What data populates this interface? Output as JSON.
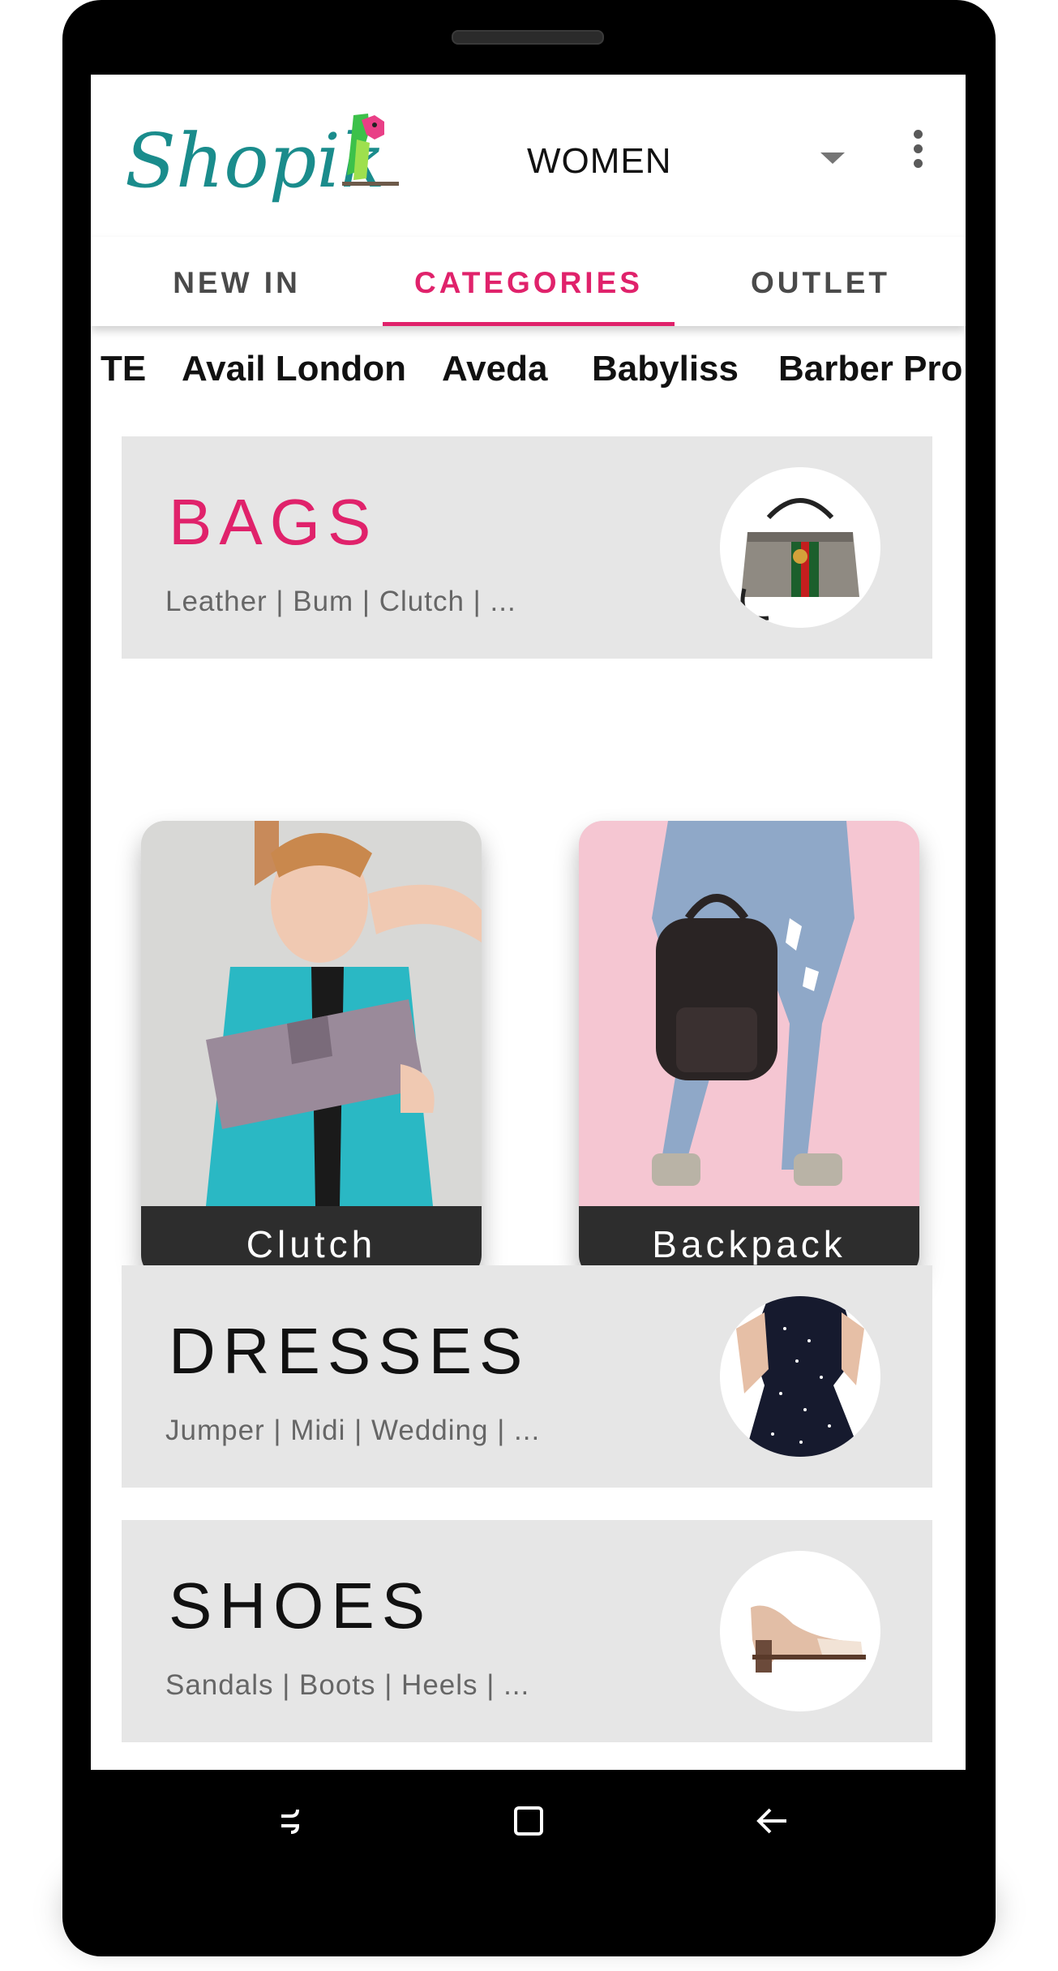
{
  "app": {
    "logo_text": "Shopik",
    "gender_selector": "WOMEN",
    "colors": {
      "accent": "#e0226b",
      "logo_teal": "#1a8c8c"
    }
  },
  "tabs": [
    {
      "label": "NEW IN",
      "active": false
    },
    {
      "label": "CATEGORIES",
      "active": true
    },
    {
      "label": "OUTLET",
      "active": false
    }
  ],
  "brands": [
    "TE",
    "Avail London",
    "Aveda",
    "Babyliss",
    "Barber Pro"
  ],
  "categories": {
    "bags": {
      "title": "BAGS",
      "subtitle": "Leather | Bum | Clutch | ...",
      "icon": "handbag-image"
    },
    "dresses": {
      "title": "DRESSES",
      "subtitle": "Jumper | Midi | Wedding | ...",
      "icon": "dress-image"
    },
    "shoes": {
      "title": "SHOES",
      "subtitle": "Sandals | Boots | Heels | ...",
      "icon": "heel-shoe-image"
    }
  },
  "subcategories": [
    {
      "label": "Clutch",
      "icon": "clutch-photo"
    },
    {
      "label": "Backpack",
      "icon": "backpack-photo"
    }
  ],
  "navbar": [
    "recent-apps-icon",
    "home-icon",
    "back-icon"
  ]
}
